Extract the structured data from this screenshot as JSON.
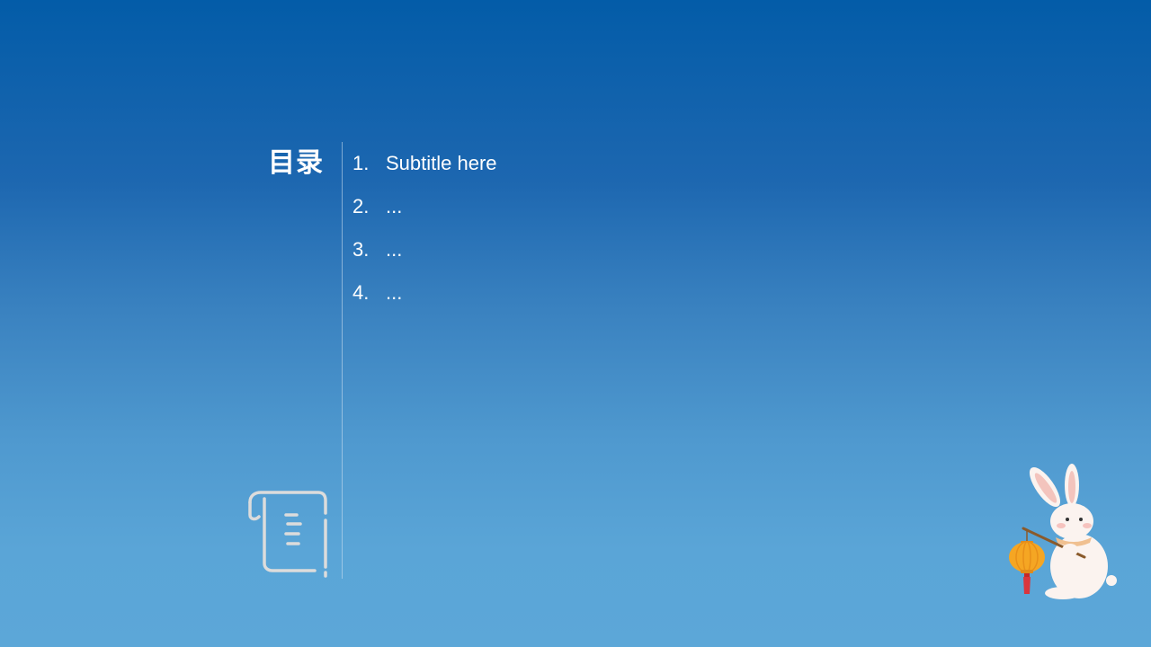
{
  "toc": {
    "title": "目录",
    "items": [
      {
        "number": "1.",
        "label": "Subtitle here"
      },
      {
        "number": "2.",
        "label": "..."
      },
      {
        "number": "3.",
        "label": "..."
      },
      {
        "number": "4.",
        "label": "..."
      }
    ]
  },
  "icons": {
    "scroll": "scroll-icon",
    "illustration": "rabbit-lantern-illustration"
  },
  "colors": {
    "background_top": "#035ca8",
    "background_bottom": "#5ca7d8",
    "text": "#ffffff",
    "icon_stroke": "#dcdcdc",
    "lantern": "#f5a623",
    "tassel": "#d9363e"
  }
}
